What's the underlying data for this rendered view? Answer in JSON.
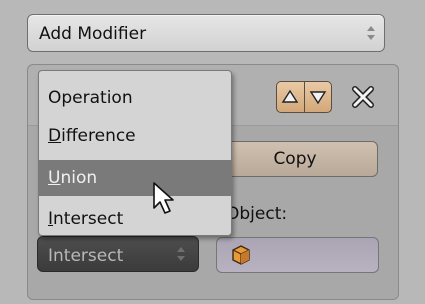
{
  "add_modifier": {
    "label": "Add Modifier"
  },
  "menu": {
    "title": "Operation",
    "items": [
      {
        "mnemonic": "D",
        "rest": "ifference",
        "highlighted": false
      },
      {
        "mnemonic": "U",
        "rest": "nion",
        "highlighted": true
      },
      {
        "mnemonic": "I",
        "rest": "ntersect",
        "highlighted": false
      }
    ]
  },
  "modifier": {
    "copy_label": "Copy",
    "object_label": "Object:",
    "operation_value": "Intersect"
  },
  "icons": {
    "updown": "up-down-arrows-icon",
    "move_up": "triangle-up-icon",
    "move_down": "triangle-down-icon",
    "close": "close-icon",
    "object": "cube-icon",
    "cursor": "mouse-cursor-icon"
  },
  "colors": {
    "highlight": "#7a7a7a",
    "move_buttons": "#d3a87a",
    "copy_button": "#b9a998",
    "object_field": "#aaa4b4",
    "operation_select": "#3b3b3b"
  }
}
